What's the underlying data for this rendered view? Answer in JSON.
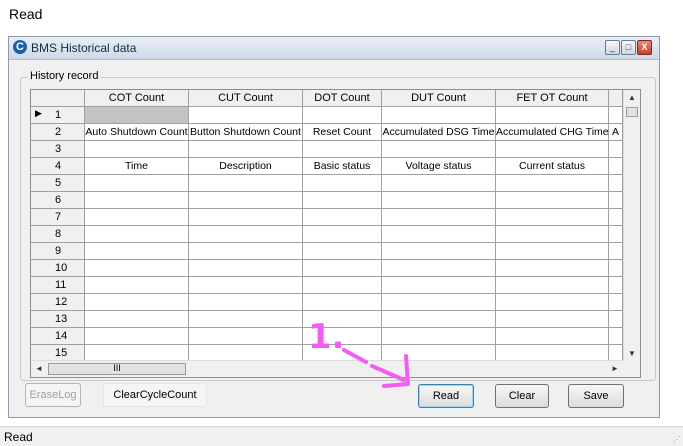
{
  "caption": "Read",
  "window": {
    "title": "BMS Historical data",
    "controls": [
      "_",
      "□",
      "X"
    ]
  },
  "group": {
    "label": "History record"
  },
  "grid": {
    "columns": [
      "COT Count",
      "CUT Count",
      "DOT Count",
      "DUT Count",
      "FET OT Count"
    ],
    "rows": [
      {
        "num": "1",
        "current": true,
        "cells": [
          "",
          "",
          "",
          "",
          ""
        ]
      },
      {
        "num": "2",
        "cells": [
          "Auto Shutdown Count",
          "Button Shutdown Count",
          "Reset Count",
          "Accumulated DSG Time",
          "Accumulated CHG Time"
        ]
      },
      {
        "num": "3",
        "cells": [
          "",
          "",
          "",
          "",
          ""
        ]
      },
      {
        "num": "4",
        "cells": [
          "Time",
          "Description",
          "Basic status",
          "Voltage status",
          "Current status"
        ]
      },
      {
        "num": "5",
        "cells": [
          "",
          "",
          "",
          "",
          ""
        ]
      },
      {
        "num": "6",
        "cells": [
          "",
          "",
          "",
          "",
          ""
        ]
      },
      {
        "num": "7",
        "cells": [
          "",
          "",
          "",
          "",
          ""
        ]
      },
      {
        "num": "8",
        "cells": [
          "",
          "",
          "",
          "",
          ""
        ]
      },
      {
        "num": "9",
        "cells": [
          "",
          "",
          "",
          "",
          ""
        ]
      },
      {
        "num": "10",
        "cells": [
          "",
          "",
          "",
          "",
          ""
        ]
      },
      {
        "num": "11",
        "cells": [
          "",
          "",
          "",
          "",
          ""
        ]
      },
      {
        "num": "12",
        "cells": [
          "",
          "",
          "",
          "",
          ""
        ]
      },
      {
        "num": "13",
        "cells": [
          "",
          "",
          "",
          "",
          ""
        ]
      },
      {
        "num": "14",
        "cells": [
          "",
          "",
          "",
          "",
          ""
        ]
      },
      {
        "num": "15",
        "cells": [
          "",
          "",
          "",
          "",
          ""
        ]
      }
    ],
    "overflow_cell": "A",
    "hscroll_thumb": "III"
  },
  "buttons": {
    "erase_log": "EraseLog",
    "clear_cycle_count": "ClearCycleCount",
    "read": "Read",
    "clear": "Clear",
    "save": "Save"
  },
  "status": {
    "text": "Read"
  },
  "annotation": {
    "text": "1.",
    "color": "#f25cf0"
  }
}
